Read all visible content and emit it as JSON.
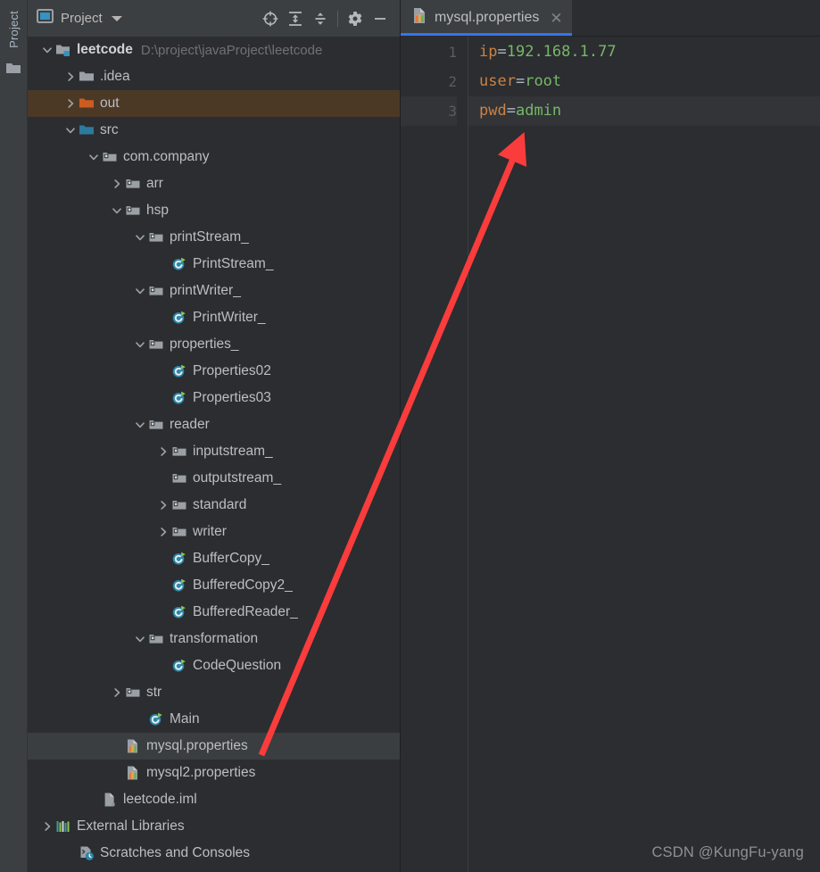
{
  "toolstrip": {
    "tab_label": "Project",
    "folder_icon": "folder-icon"
  },
  "project_panel": {
    "header": {
      "title": "Project",
      "window_icon": "project-window-icon",
      "dropdown_icon": "chevron-down-icon",
      "buttons": [
        {
          "name": "locate-in-tree-button",
          "icon": "crosshair-target-icon",
          "label": ""
        },
        {
          "name": "expand-all-button",
          "icon": "expand-all-icon",
          "label": ""
        },
        {
          "name": "collapse-all-button",
          "icon": "collapse-all-icon",
          "label": ""
        },
        {
          "name": "settings-button",
          "icon": "gear-icon",
          "label": ""
        },
        {
          "name": "hide-panel-button",
          "icon": "minimize-icon",
          "label": ""
        }
      ]
    },
    "tree": [
      {
        "label": "leetcode",
        "path": "D:\\project\\javaProject\\leetcode",
        "indent": 0,
        "arrow": "down",
        "icon": "module-folder-icon",
        "bold": true,
        "state": "normal"
      },
      {
        "label": ".idea",
        "path": "",
        "indent": 1,
        "arrow": "right",
        "icon": "folder-gray-icon",
        "bold": false,
        "state": "normal"
      },
      {
        "label": "out",
        "path": "",
        "indent": 1,
        "arrow": "right",
        "icon": "folder-orange-icon",
        "bold": false,
        "state": "excluded"
      },
      {
        "label": "src",
        "path": "",
        "indent": 1,
        "arrow": "down",
        "icon": "folder-source-icon",
        "bold": false,
        "state": "normal"
      },
      {
        "label": "com.company",
        "path": "",
        "indent": 2,
        "arrow": "down",
        "icon": "package-icon",
        "bold": false,
        "state": "normal"
      },
      {
        "label": "arr",
        "path": "",
        "indent": 3,
        "arrow": "right",
        "icon": "package-icon",
        "bold": false,
        "state": "normal"
      },
      {
        "label": "hsp",
        "path": "",
        "indent": 3,
        "arrow": "down",
        "icon": "package-icon",
        "bold": false,
        "state": "normal"
      },
      {
        "label": "printStream_",
        "path": "",
        "indent": 4,
        "arrow": "down",
        "icon": "package-icon",
        "bold": false,
        "state": "normal"
      },
      {
        "label": "PrintStream_",
        "path": "",
        "indent": 5,
        "arrow": "none",
        "icon": "java-class-runnable-icon",
        "bold": false,
        "state": "normal"
      },
      {
        "label": "printWriter_",
        "path": "",
        "indent": 4,
        "arrow": "down",
        "icon": "package-icon",
        "bold": false,
        "state": "normal"
      },
      {
        "label": "PrintWriter_",
        "path": "",
        "indent": 5,
        "arrow": "none",
        "icon": "java-class-runnable-icon",
        "bold": false,
        "state": "normal"
      },
      {
        "label": "properties_",
        "path": "",
        "indent": 4,
        "arrow": "down",
        "icon": "package-icon",
        "bold": false,
        "state": "normal"
      },
      {
        "label": "Properties02",
        "path": "",
        "indent": 5,
        "arrow": "none",
        "icon": "java-class-runnable-icon",
        "bold": false,
        "state": "normal"
      },
      {
        "label": "Properties03",
        "path": "",
        "indent": 5,
        "arrow": "none",
        "icon": "java-class-runnable-icon",
        "bold": false,
        "state": "normal"
      },
      {
        "label": "reader",
        "path": "",
        "indent": 4,
        "arrow": "down",
        "icon": "package-icon",
        "bold": false,
        "state": "normal"
      },
      {
        "label": "inputstream_",
        "path": "",
        "indent": 5,
        "arrow": "right",
        "icon": "package-icon",
        "bold": false,
        "state": "normal"
      },
      {
        "label": "outputstream_",
        "path": "",
        "indent": 5,
        "arrow": "none",
        "icon": "package-icon",
        "bold": false,
        "state": "normal"
      },
      {
        "label": "standard",
        "path": "",
        "indent": 5,
        "arrow": "right",
        "icon": "package-icon",
        "bold": false,
        "state": "normal"
      },
      {
        "label": "writer",
        "path": "",
        "indent": 5,
        "arrow": "right",
        "icon": "package-icon",
        "bold": false,
        "state": "normal"
      },
      {
        "label": "BufferCopy_",
        "path": "",
        "indent": 5,
        "arrow": "none",
        "icon": "java-class-runnable-icon",
        "bold": false,
        "state": "normal"
      },
      {
        "label": "BufferedCopy2_",
        "path": "",
        "indent": 5,
        "arrow": "none",
        "icon": "java-class-runnable-icon",
        "bold": false,
        "state": "normal"
      },
      {
        "label": "BufferedReader_",
        "path": "",
        "indent": 5,
        "arrow": "none",
        "icon": "java-class-runnable-icon",
        "bold": false,
        "state": "normal"
      },
      {
        "label": "transformation",
        "path": "",
        "indent": 4,
        "arrow": "down",
        "icon": "package-icon",
        "bold": false,
        "state": "normal"
      },
      {
        "label": "CodeQuestion",
        "path": "",
        "indent": 5,
        "arrow": "none",
        "icon": "java-class-runnable-icon",
        "bold": false,
        "state": "normal"
      },
      {
        "label": "str",
        "path": "",
        "indent": 3,
        "arrow": "right",
        "icon": "package-icon",
        "bold": false,
        "state": "normal"
      },
      {
        "label": "Main",
        "path": "",
        "indent": 4,
        "arrow": "none",
        "icon": "java-class-runnable-icon",
        "bold": false,
        "state": "normal"
      },
      {
        "label": "mysql.properties",
        "path": "",
        "indent": 3,
        "arrow": "none",
        "icon": "properties-file-icon",
        "bold": false,
        "state": "selected"
      },
      {
        "label": "mysql2.properties",
        "path": "",
        "indent": 3,
        "arrow": "none",
        "icon": "properties-file-icon",
        "bold": false,
        "state": "normal"
      },
      {
        "label": "leetcode.iml",
        "path": "",
        "indent": 2,
        "arrow": "none",
        "icon": "iml-file-icon",
        "bold": false,
        "state": "normal"
      },
      {
        "label": "External Libraries",
        "path": "",
        "indent": 0,
        "arrow": "right",
        "icon": "libraries-icon",
        "bold": false,
        "state": "normal"
      },
      {
        "label": "Scratches and Consoles",
        "path": "",
        "indent": 1,
        "arrow": "none",
        "icon": "scratches-icon",
        "bold": false,
        "state": "normal"
      }
    ]
  },
  "editor": {
    "tab": {
      "label": "mysql.properties",
      "icon": "properties-file-icon",
      "close_icon": "close-icon"
    },
    "line_numbers": [
      "1",
      "2",
      "3"
    ],
    "lines": [
      {
        "key": "ip",
        "sep": "=",
        "value": "192.168.1.77",
        "current": false
      },
      {
        "key": "user",
        "sep": "=",
        "value": "root",
        "current": false
      },
      {
        "key": "pwd",
        "sep": "=",
        "value": "admin",
        "current": true
      }
    ]
  },
  "annotation": {
    "arrow_color": "#fa3c3c",
    "watermark": "CSDN @KungFu-yang"
  },
  "colors": {
    "accent": "#3574f0",
    "key": "#cc8242",
    "value": "#77b767",
    "excluded_row": "#4b3926",
    "selected_row": "#3b3e40"
  }
}
